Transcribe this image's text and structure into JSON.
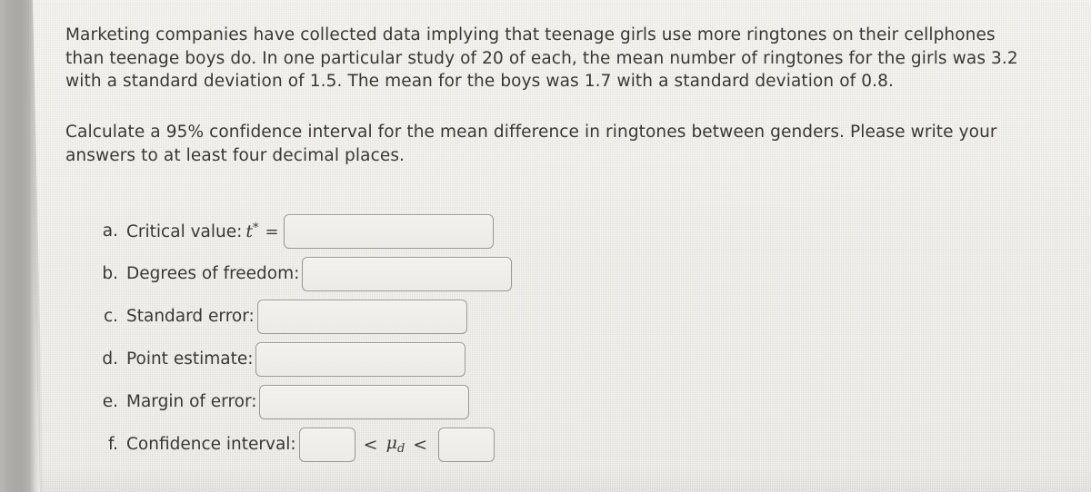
{
  "problem": {
    "paragraph_1": "Marketing companies have collected data implying that teenage girls use more ringtones on their cellphones than teenage boys do. In one particular study of 20 of each, the mean number of ringtones for the girls was 3.2 with a standard deviation of 1.5. The mean for the boys was 1.7 with a standard deviation of 0.8.",
    "paragraph_2": "Calculate a 95% confidence interval for the mean difference in ringtones between genders. Please write your answers to at least four decimal places."
  },
  "answers": {
    "items": [
      {
        "marker": "a.",
        "label": "Critical value:",
        "symbol": "t",
        "superscript": "*",
        "equals": "=",
        "value": "",
        "placeholder": ""
      },
      {
        "marker": "b.",
        "label": "Degrees of freedom:",
        "value": "",
        "placeholder": ""
      },
      {
        "marker": "c.",
        "label": "Standard error:",
        "value": "",
        "placeholder": ""
      },
      {
        "marker": "d.",
        "label": "Point estimate:",
        "value": "",
        "placeholder": ""
      },
      {
        "marker": "e.",
        "label": "Margin of error:",
        "value": "",
        "placeholder": ""
      },
      {
        "marker": "f.",
        "label": "Confidence interval:",
        "lower_value": "",
        "upper_value": "",
        "left_operator": "<",
        "right_operator": "<",
        "parameter": "μ",
        "parameter_subscript": "d"
      }
    ]
  },
  "colors": {
    "page_background": "#eceae5",
    "text": "#3b3734",
    "input_border": "#9a9894",
    "input_fill": "#efeeea",
    "bezel_gray": "#a9a7a3"
  }
}
